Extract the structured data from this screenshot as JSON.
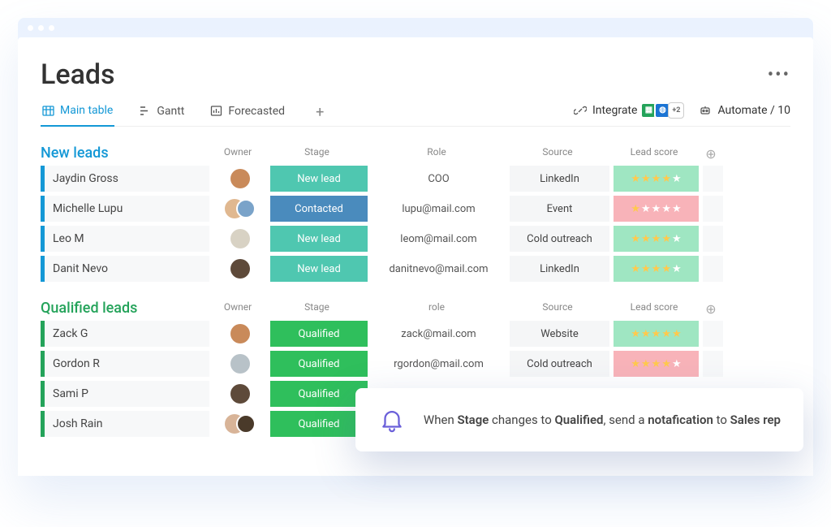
{
  "title": "Leads",
  "views": [
    {
      "label": "Main table",
      "icon": "table",
      "active": true
    },
    {
      "label": "Gantt",
      "icon": "gantt",
      "active": false
    },
    {
      "label": "Forecasted",
      "icon": "chart",
      "active": false
    }
  ],
  "integrate_label": "Integrate",
  "integrate_more": "+2",
  "automate_label": "Automate / 10",
  "groups": [
    {
      "id": "new-leads",
      "title": "New leads",
      "columns": [
        "Owner",
        "Stage",
        "Role",
        "Source",
        "Lead score"
      ],
      "rows": [
        {
          "name": "Jaydin Gross",
          "owners": 1,
          "avatarColors": [
            "#c98a5a"
          ],
          "stage": "New lead",
          "stageClass": "stage-teal",
          "role": "COO",
          "source": "LinkedIn",
          "score": 4,
          "scoreClass": "score-green"
        },
        {
          "name": "Michelle Lupu",
          "owners": 2,
          "avatarColors": [
            "#e0b890",
            "#7aa3c9"
          ],
          "stage": "Contacted",
          "stageClass": "stage-blue",
          "role": "lupu@mail.com",
          "source": "Event",
          "score": 1,
          "scoreClass": "score-red"
        },
        {
          "name": "Leo M",
          "owners": 1,
          "avatarColors": [
            "#d8d2c4"
          ],
          "stage": "New lead",
          "stageClass": "stage-teal",
          "role": "leom@mail.com",
          "source": "Cold outreach",
          "score": 4,
          "scoreClass": "score-green"
        },
        {
          "name": "Danit Nevo",
          "owners": 1,
          "avatarColors": [
            "#5e4a3a"
          ],
          "stage": "New lead",
          "stageClass": "stage-teal",
          "role": "danitnevo@mail.com",
          "source": "LinkedIn",
          "score": 4,
          "scoreClass": "score-green"
        }
      ]
    },
    {
      "id": "qualified",
      "title": "Qualified leads",
      "columns": [
        "Owner",
        "Stage",
        "role",
        "Source",
        "Lead score"
      ],
      "rows": [
        {
          "name": "Zack G",
          "owners": 1,
          "avatarColors": [
            "#c98a5a"
          ],
          "stage": "Qualified",
          "stageClass": "stage-green",
          "role": "zack@mail.com",
          "source": "Website",
          "score": 5,
          "scoreClass": "score-green"
        },
        {
          "name": "Gordon R",
          "owners": 1,
          "avatarColors": [
            "#b8c2c8"
          ],
          "stage": "Qualified",
          "stageClass": "stage-green",
          "role": "rgordon@mail.com",
          "source": "Cold outreach",
          "score": 4,
          "scoreClass": "score-red"
        },
        {
          "name": "Sami P",
          "owners": 1,
          "avatarColors": [
            "#5e4a3a"
          ],
          "stage": "Qualified",
          "stageClass": "stage-green",
          "role": "",
          "source": "",
          "score": 0,
          "scoreClass": ""
        },
        {
          "name": "Josh Rain",
          "owners": 2,
          "avatarColors": [
            "#d8b498",
            "#4a3a2a"
          ],
          "stage": "Qualified",
          "stageClass": "stage-green",
          "role": "",
          "source": "",
          "score": 0,
          "scoreClass": ""
        }
      ]
    }
  ],
  "notification": {
    "prefix": "When ",
    "b1": "Stage",
    "mid1": " changes to ",
    "b2": "Qualified",
    "mid2": ", send a ",
    "b3": "notafication",
    "mid3": " to ",
    "b4": "Sales rep"
  }
}
